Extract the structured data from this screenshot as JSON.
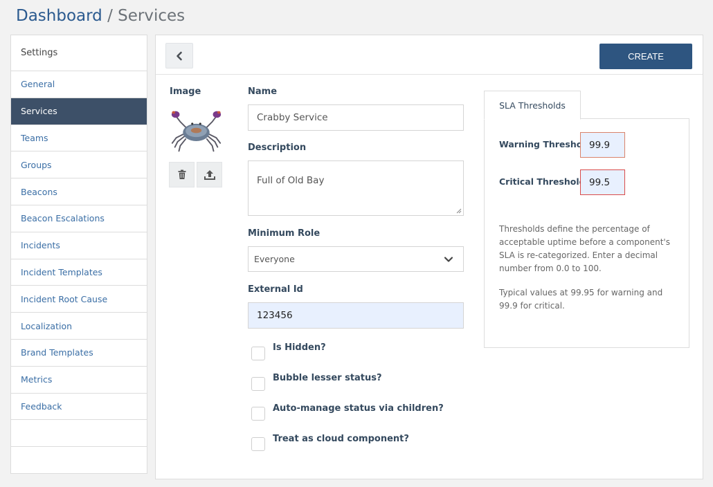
{
  "breadcrumb": {
    "home": "Dashboard",
    "separator": "/",
    "current": "Services"
  },
  "sidebar": {
    "title": "Settings",
    "items": [
      {
        "label": "General"
      },
      {
        "label": "Services",
        "active": true
      },
      {
        "label": "Teams"
      },
      {
        "label": "Groups"
      },
      {
        "label": "Beacons"
      },
      {
        "label": "Beacon Escalations"
      },
      {
        "label": "Incidents"
      },
      {
        "label": "Incident Templates"
      },
      {
        "label": "Incident Root Cause"
      },
      {
        "label": "Localization"
      },
      {
        "label": "Brand Templates"
      },
      {
        "label": "Metrics"
      },
      {
        "label": "Feedback"
      }
    ]
  },
  "toolbar": {
    "back_icon": "chevron-left-icon",
    "create_label": "CREATE"
  },
  "form": {
    "image_label": "Image",
    "image_alt": "crab",
    "delete_icon": "trash-icon",
    "upload_icon": "upload-icon",
    "name_label": "Name",
    "name_value": "Crabby Service",
    "description_label": "Description",
    "description_value": "Full of Old Bay",
    "min_role_label": "Minimum Role",
    "min_role_value": "Everyone",
    "external_id_label": "External Id",
    "external_id_value": "123456",
    "checkboxes": [
      {
        "label": "Is Hidden?",
        "checked": false
      },
      {
        "label": "Bubble lesser status?",
        "checked": false
      },
      {
        "label": "Auto-manage status via children?",
        "checked": false
      },
      {
        "label": "Treat as cloud component?",
        "checked": false
      }
    ]
  },
  "sla": {
    "tab_label": "SLA Thresholds",
    "warning_label": "Warning Threshold:",
    "warning_value": "99.9",
    "critical_label": "Critical Threshold:",
    "critical_value": "99.5",
    "note_1": "Thresholds define the percentage of acceptable uptime before a component's SLA is re-categorized. Enter a decimal number from 0.0 to 100.",
    "note_2": "Typical values at 99.95 for warning and 99.9 for critical."
  },
  "colors": {
    "primary": "#2e5580",
    "active_nav": "#3d5068",
    "link": "#3a6ea5"
  }
}
